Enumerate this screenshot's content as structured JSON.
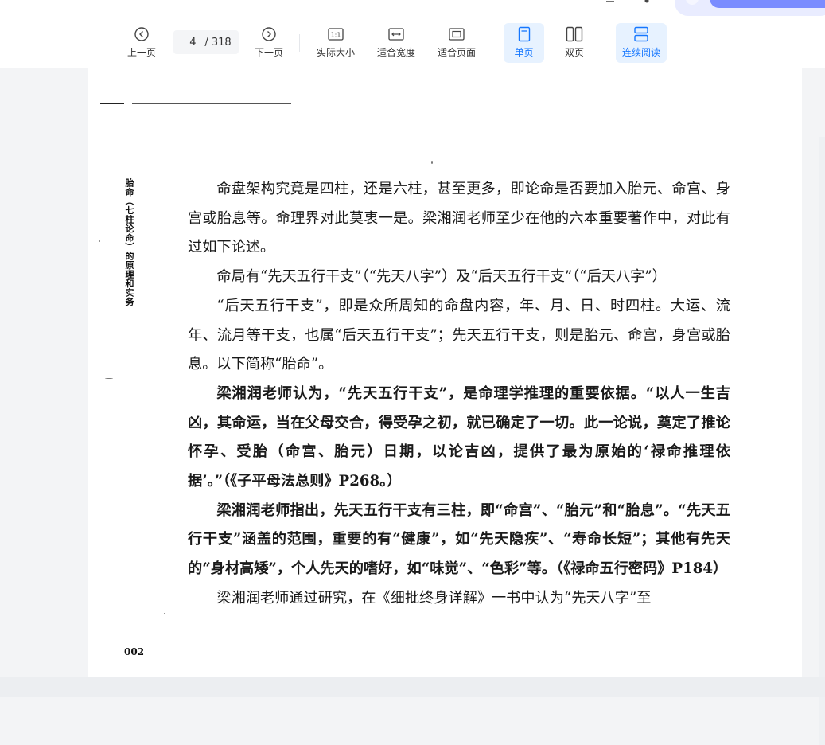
{
  "toolbar": {
    "prev_label": "上一页",
    "current_page": "4",
    "total_pages": "/ 318",
    "next_label": "下一页",
    "actual_size_label": "实际大小",
    "actual_size_icon_text": "1:1",
    "fit_width_label": "适合宽度",
    "fit_page_label": "适合页面",
    "single_page_label": "单页",
    "double_page_label": "双页",
    "continuous_label": "连续阅读"
  },
  "icons": {
    "prev": "chevron-left-circle-icon",
    "next": "chevron-right-circle-icon",
    "actual_size": "actual-size-icon",
    "fit_width": "fit-width-icon",
    "fit_page": "fit-page-icon",
    "single_page": "single-page-icon",
    "double_page": "double-page-icon",
    "continuous": "continuous-read-icon"
  },
  "colors": {
    "accent": "#1677ff",
    "active_bg": "#e7f2ff",
    "promo": "#7a8cff"
  },
  "page": {
    "side_title": "胎命（七柱论命）的原理和实务",
    "page_number": "002",
    "paragraphs": [
      "命盘架构究竟是四柱，还是六柱，甚至更多，即论命是否要加入胎元、命宫、身宫或胎息等。命理界对此莫衷一是。梁湘润老师至少在他的六本重要著作中，对此有过如下论述。",
      "命局有“先天五行干支”（“先天八字”）及“后天五行干支”（“后天八字”）",
      "“后天五行干支”，即是众所周知的命盘内容，年、月、日、时四柱。大运、流年、流月等干支，也属“后天五行干支”；先天五行干支，则是胎元、命宫，身宫或胎息。以下简称“胎命”。",
      "梁湘润老师认为，“先天五行干支”，是命理学推理的重要依据。“以人一生吉凶，其命运，当在父母交合，得受孕之初，就已确定了一切。此一论说，奠定了推论怀孕、受胎（命宫、胎元）日期，以论吉凶，提供了最为原始的‘禄命推理依据’。”（《子平母法总则》P268。）",
      "梁湘润老师指出，先天五行干支有三柱，即“命宫”、“胎元”和“胎息”。“先天五行干支”涵盖的范围，重要的有“健康”，如“先天隐疾”、“寿命长短”；其他有先天的“身材高矮”，个人先天的嗜好，如“味觉”、“色彩”等。（《禄命五行密码》P184）",
      "梁湘润老师通过研究，在《细批终身详解》一书中认为“先天八字”至"
    ]
  }
}
